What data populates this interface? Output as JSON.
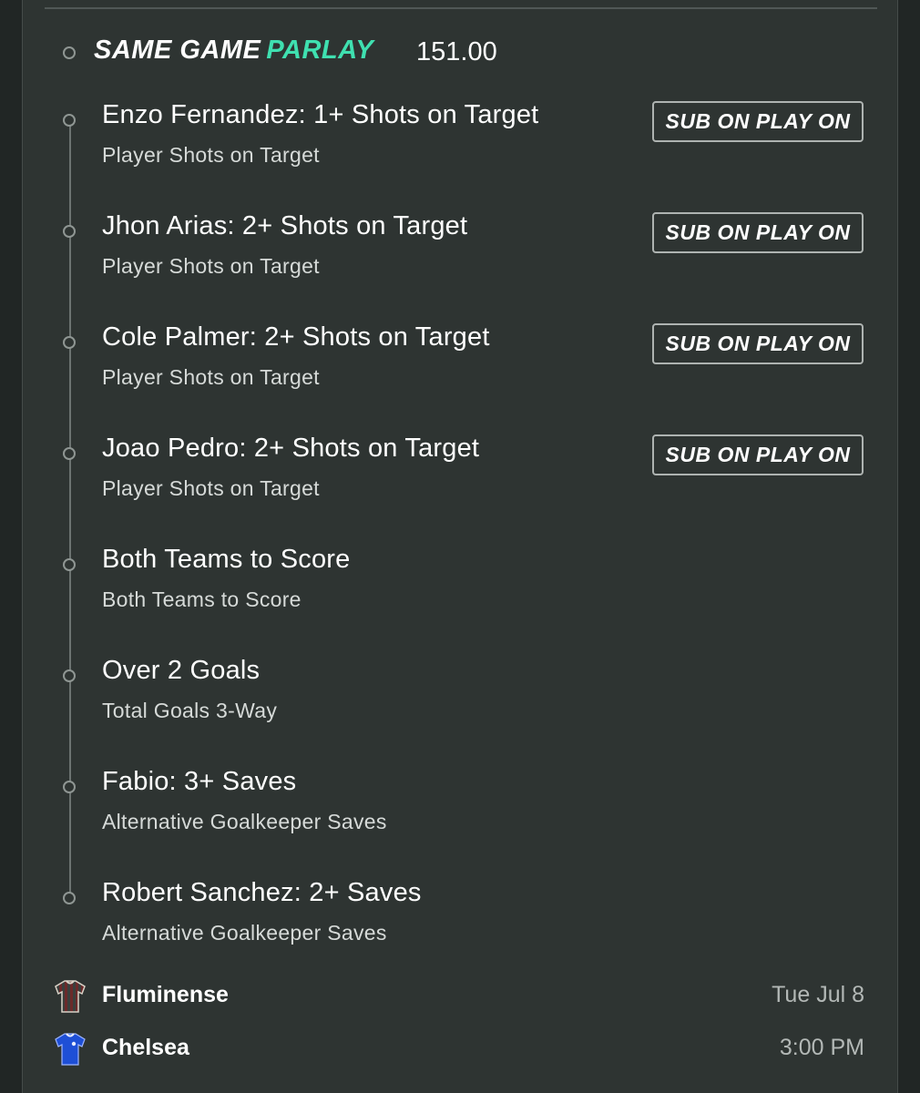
{
  "header": {
    "title_part1": "SAME GAME",
    "title_part2": "PARLAY",
    "odds": "151.00",
    "accent_color": "#3fe0b0"
  },
  "legs": [
    {
      "title": "Enzo Fernandez: 1+ Shots on Target",
      "market": "Player Shots on Target",
      "button": "SUB ON PLAY ON"
    },
    {
      "title": "Jhon Arias: 2+ Shots on Target",
      "market": "Player Shots on Target",
      "button": "SUB ON PLAY ON"
    },
    {
      "title": "Cole Palmer: 2+ Shots on Target",
      "market": "Player Shots on Target",
      "button": "SUB ON PLAY ON"
    },
    {
      "title": "Joao Pedro: 2+ Shots on Target",
      "market": "Player Shots on Target",
      "button": "SUB ON PLAY ON"
    },
    {
      "title": "Both Teams to Score",
      "market": "Both Teams to Score"
    },
    {
      "title": "Over 2 Goals",
      "market": "Total Goals 3-Way"
    },
    {
      "title": "Fabio: 3+ Saves",
      "market": "Alternative Goalkeeper Saves"
    },
    {
      "title": "Robert Sanchez: 2+ Saves",
      "market": "Alternative Goalkeeper Saves"
    }
  ],
  "match": {
    "home": {
      "name": "Fluminense",
      "meta": "Tue Jul 8",
      "icon": "fluminense-jersey-icon"
    },
    "away": {
      "name": "Chelsea",
      "meta": "3:00 PM",
      "icon": "chelsea-jersey-icon"
    }
  }
}
